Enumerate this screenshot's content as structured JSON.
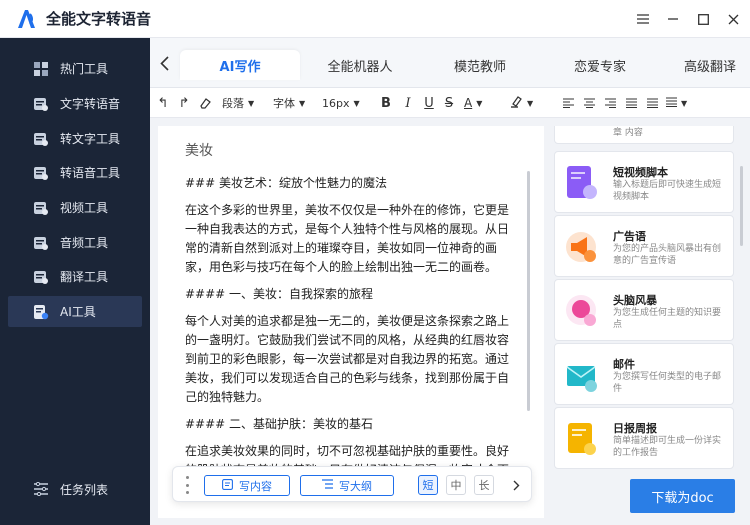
{
  "app": {
    "title": "全能文字转语音"
  },
  "sidebar": {
    "items": [
      {
        "label": "热门工具",
        "icon": "grid-icon"
      },
      {
        "label": "文字转语音",
        "icon": "text-to-speech-icon"
      },
      {
        "label": "转文字工具",
        "icon": "to-text-icon"
      },
      {
        "label": "转语音工具",
        "icon": "to-voice-icon"
      },
      {
        "label": "视频工具",
        "icon": "video-icon"
      },
      {
        "label": "音频工具",
        "icon": "audio-icon"
      },
      {
        "label": "翻译工具",
        "icon": "translate-icon"
      },
      {
        "label": "AI工具",
        "icon": "ai-tools-icon",
        "active": true
      }
    ],
    "task_list": "任务列表"
  },
  "tabs": [
    {
      "label": "AI写作",
      "active": true
    },
    {
      "label": "全能机器人"
    },
    {
      "label": "模范教师"
    },
    {
      "label": "恋爱专家"
    },
    {
      "label": "高级翻译"
    }
  ],
  "toolbar": {
    "paragraph": "段落",
    "font": "字体",
    "font_size": "16px"
  },
  "document": {
    "title": "美妆",
    "paragraphs": [
      "### 美妆艺术：绽放个性魅力的魔法",
      "在这个多彩的世界里，美妆不仅仅是一种外在的修饰，它更是一种自我表达的方式，是每个人独特个性与风格的展现。从日常的清新自然到派对上的璀璨夺目，美妆如同一位神奇的画家，用色彩与技巧在每个人的脸上绘制出独一无二的画卷。",
      "#### 一、美妆：自我探索的旅程",
      "每个人对美的追求都是独一无二的，美妆便是这条探索之路上的一盏明灯。它鼓励我们尝试不同的风格，从经典的红唇妆容到前卫的彩色眼影，每一次尝试都是对自我边界的拓宽。通过美妆，我们可以发现适合自己的色彩与线条，找到那份属于自己的独特魅力。",
      "#### 二、基础护肤：美妆的基石",
      "在追求美妆效果的同时，切不可忽视基础护肤的重要性。良好的肌肤状态是美妆的基础，只有做好清洁与保湿，妆容才会更加服帖。"
    ]
  },
  "bottom_bar": {
    "write_content": "写内容",
    "write_outline": "写大纲",
    "len_short": "短",
    "len_medium": "中",
    "len_long": "长"
  },
  "cards": [
    {
      "title": "",
      "desc": "章 内容",
      "icon": "partial-card-icon"
    },
    {
      "title": "短视频脚本",
      "desc": "输入标题后即可快速生成短视频脚本",
      "icon": "video-script-icon",
      "color": "#8b5cf6"
    },
    {
      "title": "广告语",
      "desc": "为您的产品头脑风暴出有创意的广告宣传语",
      "icon": "megaphone-icon",
      "color": "#f97316"
    },
    {
      "title": "头脑风暴",
      "desc": "为您生成任何主题的知识要点",
      "icon": "brain-icon",
      "color": "#ec4899"
    },
    {
      "title": "邮件",
      "desc": "为您撰写任何类型的电子邮件",
      "icon": "mail-icon",
      "color": "#22b8c9"
    },
    {
      "title": "日报周报",
      "desc": "简单描述即可生成一份详实的工作报告",
      "icon": "report-icon",
      "color": "#f5b400"
    }
  ],
  "download_label": "下载为doc",
  "colors": {
    "accent": "#1f6feb",
    "sidebar_bg": "#1b2537",
    "download_bg": "#2a7ee6"
  }
}
